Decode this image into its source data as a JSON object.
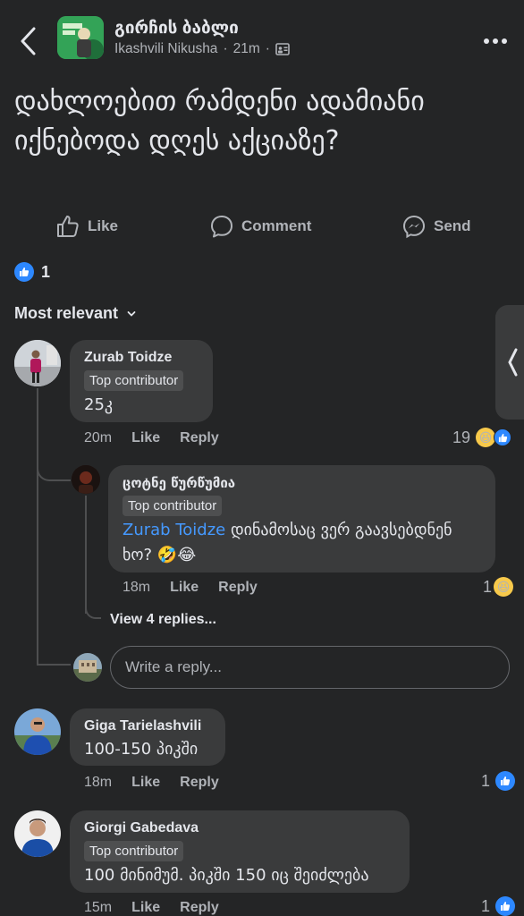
{
  "header": {
    "group_name": "გირჩის ბაბლი",
    "author": "Ikashvili Nikusha",
    "time": "21m",
    "separator": "·"
  },
  "post": {
    "text": "დახლოებით რამდენი ადამიანი იქნებოდა დღეს აქციაზე?"
  },
  "actions": {
    "like": "Like",
    "comment": "Comment",
    "send": "Send"
  },
  "reactions": {
    "count": "1"
  },
  "sort_label": "Most relevant",
  "comments": [
    {
      "author": "Zurab Toidze",
      "badge": "Top contributor",
      "text": "25კ",
      "time": "20m",
      "like": "Like",
      "reply": "Reply",
      "reaction_count": "19",
      "replies": [
        {
          "author": "ცოტნე წურწუმია",
          "badge": "Top contributor",
          "mention": "Zurab Toidze",
          "text": " დინამოსაც ვერ გაავსებდნენ ხო? 🤣😂",
          "time": "18m",
          "like": "Like",
          "reply": "Reply",
          "reaction_count": "1"
        }
      ],
      "view_replies": "View 4 replies...",
      "reply_placeholder": "Write a reply..."
    },
    {
      "author": "Giga Tarielashvili",
      "text": "100-150 პიკში",
      "time": "18m",
      "like": "Like",
      "reply": "Reply",
      "reaction_count": "1"
    },
    {
      "author": "Giorgi Gabedava",
      "badge": "Top contributor",
      "text": "100 მინიმუმ. პიკში 150 იც შეიძლება",
      "time": "15m",
      "like": "Like",
      "reply": "Reply",
      "reaction_count": "1"
    }
  ],
  "colors": {
    "background": "#242526",
    "bubble": "#3a3b3c",
    "accent": "#2d88ff",
    "mention": "#4599ff",
    "secondary_text": "#b0b3b8"
  }
}
